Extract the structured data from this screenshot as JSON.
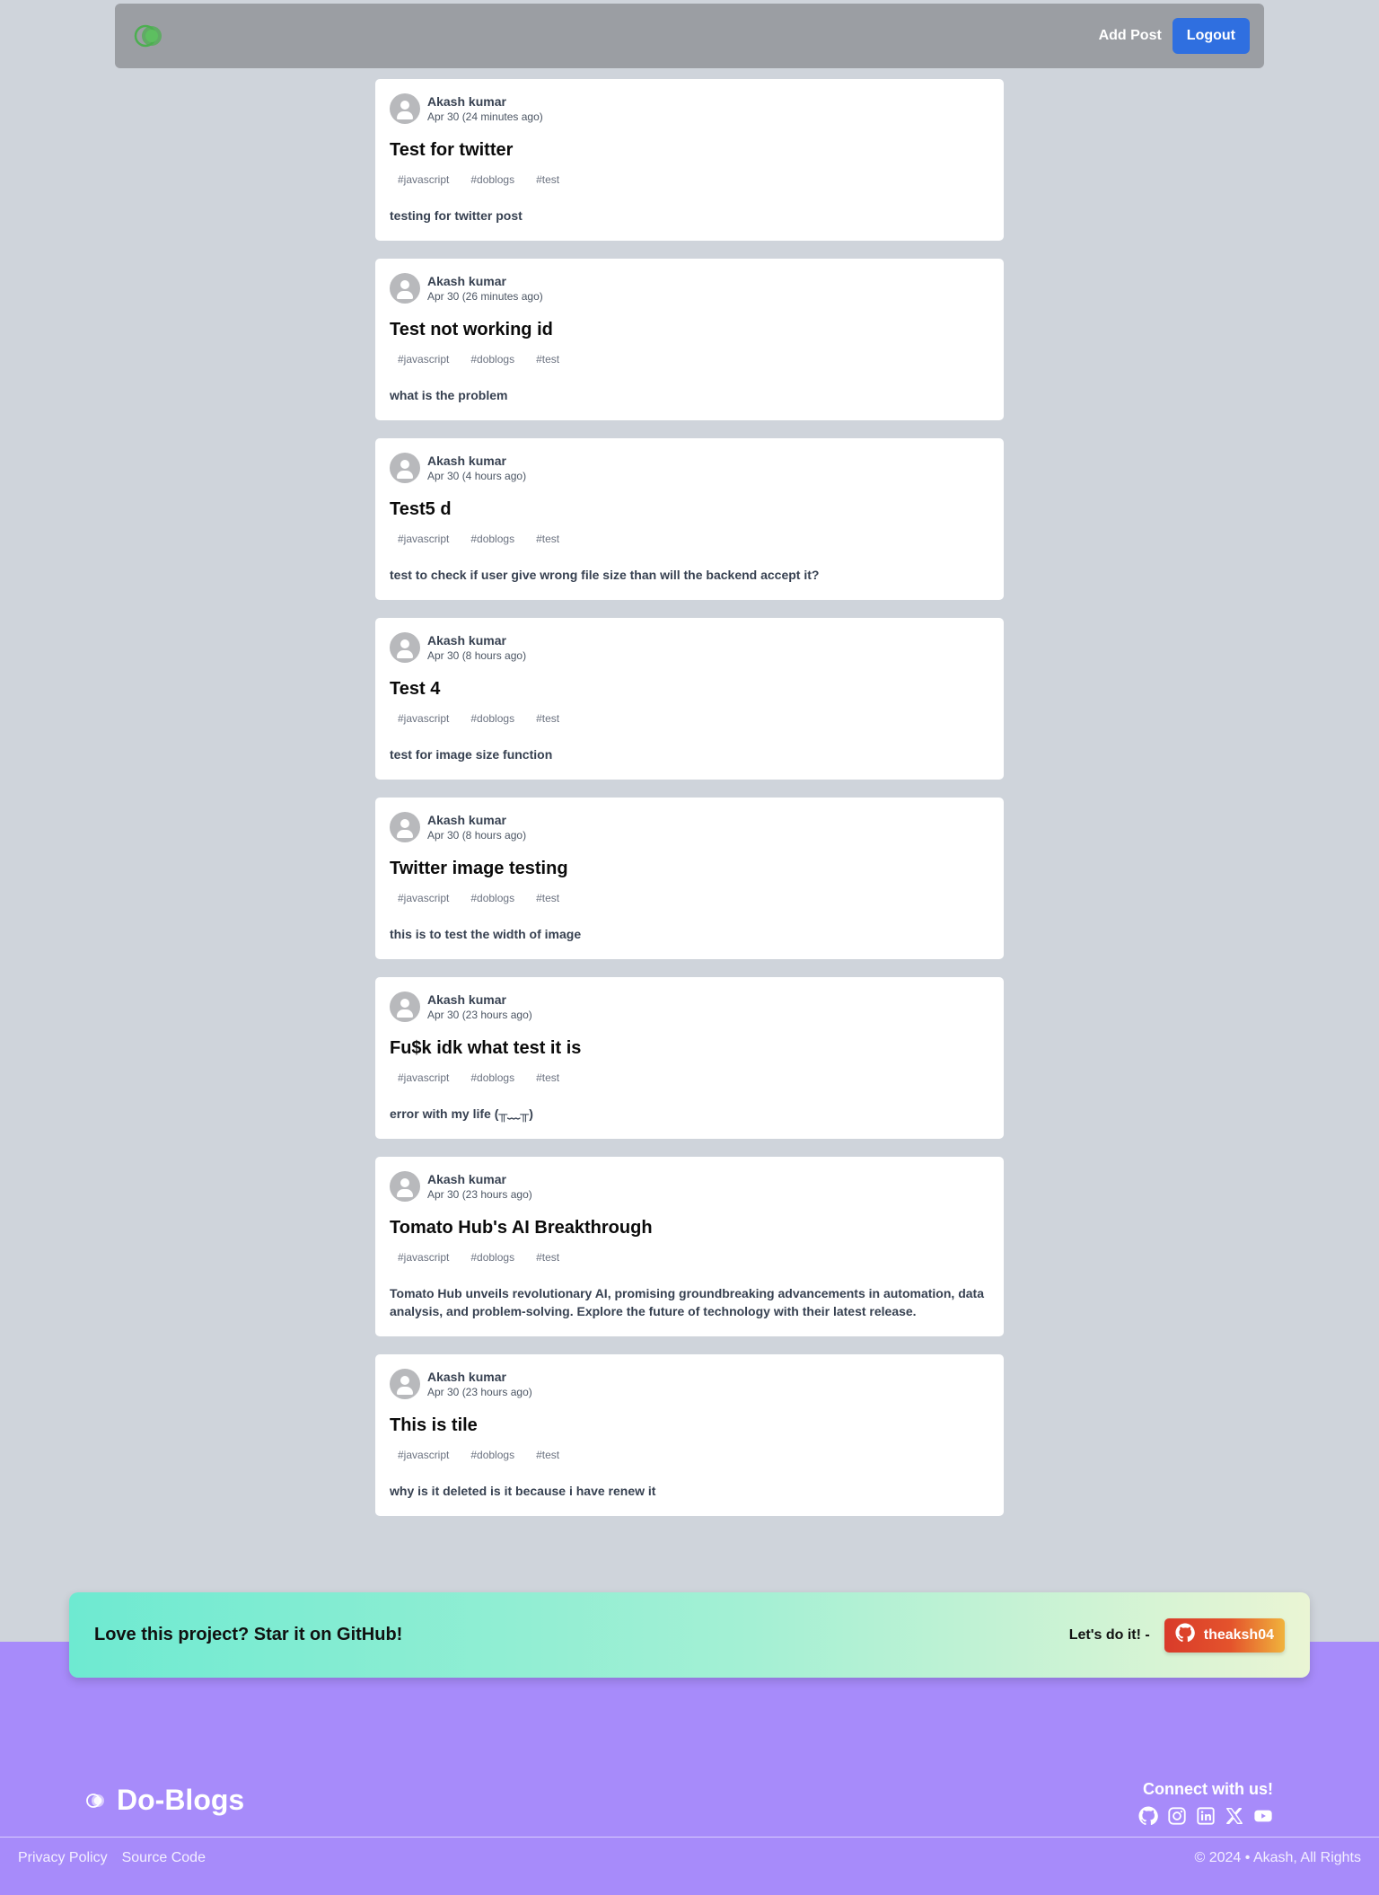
{
  "header": {
    "logo_icon": "toggle-logo-icon",
    "add_post_label": "Add Post",
    "logout_label": "Logout",
    "colors": {
      "navbar": "#9b9ea3",
      "logout_button": "#2f6fe0",
      "logo": "#4caf50"
    }
  },
  "posts": [
    {
      "author": "Akash kumar",
      "date": "Apr 30 (24 minutes ago)",
      "title": "Test for twitter",
      "tags": [
        "#javascript",
        "#doblogs",
        "#test"
      ],
      "body": "testing for twitter post"
    },
    {
      "author": "Akash kumar",
      "date": "Apr 30 (26 minutes ago)",
      "title": "Test not working id",
      "tags": [
        "#javascript",
        "#doblogs",
        "#test"
      ],
      "body": "what is the problem"
    },
    {
      "author": "Akash kumar",
      "date": "Apr 30 (4 hours ago)",
      "title": "Test5 d",
      "tags": [
        "#javascript",
        "#doblogs",
        "#test"
      ],
      "body": "test to check if user give wrong file size than will the backend accept it?"
    },
    {
      "author": "Akash kumar",
      "date": "Apr 30 (8 hours ago)",
      "title": "Test 4",
      "tags": [
        "#javascript",
        "#doblogs",
        "#test"
      ],
      "body": "test for image size function"
    },
    {
      "author": "Akash kumar",
      "date": "Apr 30 (8 hours ago)",
      "title": "Twitter image testing",
      "tags": [
        "#javascript",
        "#doblogs",
        "#test"
      ],
      "body": "this is to test the width of image"
    },
    {
      "author": "Akash kumar",
      "date": "Apr 30 (23 hours ago)",
      "title": "Fu$k idk what test it is",
      "tags": [
        "#javascript",
        "#doblogs",
        "#test"
      ],
      "body": "error with my life (╥﹏╥)"
    },
    {
      "author": "Akash kumar",
      "date": "Apr 30 (23 hours ago)",
      "title": "Tomato Hub's AI Breakthrough",
      "tags": [
        "#javascript",
        "#doblogs",
        "#test"
      ],
      "body": "Tomato Hub unveils revolutionary AI, promising groundbreaking advancements in automation, data analysis, and problem-solving. Explore the future of technology with their latest release."
    },
    {
      "author": "Akash kumar",
      "date": "Apr 30 (23 hours ago)",
      "title": "This is tile",
      "tags": [
        "#javascript",
        "#doblogs",
        "#test"
      ],
      "body": "why is it deleted is it because i have renew it"
    }
  ],
  "banner": {
    "text": "Love this project? Star it on GitHub!",
    "cta": "Let's do it! -",
    "github_button_label": "theaksh04",
    "github_icon": "github-icon"
  },
  "footer": {
    "brand": "Do-Blogs",
    "connect_title": "Connect with us!",
    "socials": [
      "github-icon",
      "instagram-icon",
      "linkedin-icon",
      "x-icon",
      "youtube-icon"
    ],
    "links": [
      "Privacy Policy",
      "Source Code"
    ],
    "copyright": "© 2024 • Akash, All Rights",
    "colors": {
      "footer_bg": "#a78bfa"
    }
  }
}
